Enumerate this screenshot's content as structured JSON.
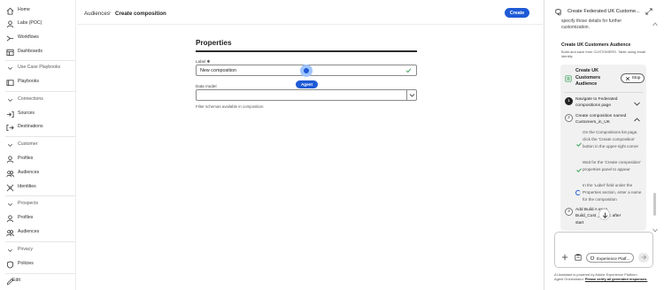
{
  "sidebar": {
    "home": "Home",
    "labs": "Labs (POC)",
    "workflows": "Workflows",
    "dashboards": "Dashboards",
    "use_case_playbooks": "Use Case Playbooks",
    "playbooks": "Playbooks",
    "connections": "Connections",
    "sources": "Sources",
    "destinations": "Destinations",
    "customer": "Customer",
    "customer_profiles": "Profiles",
    "customer_audiences": "Audiences",
    "identities": "Identities",
    "prospects": "Prospects",
    "prospect_profiles": "Profiles",
    "prospect_audiences": "Audiences",
    "privacy": "Privacy",
    "policies": "Policies",
    "edit": "Edit"
  },
  "header": {
    "breadcrumb_parent": "Audiences",
    "breadcrumb_separator": "›",
    "breadcrumb_current": "Create composition",
    "create_button": "Create"
  },
  "form": {
    "section_title": "Properties",
    "label_field_label": "Label ✱",
    "label_field_value": "New composition",
    "agent_badge": "Agent",
    "data_model_label": "Data model",
    "data_model_value": "",
    "data_model_help": "Filter schemas available in composition"
  },
  "assistant": {
    "title": "Create Federated UK Custome...",
    "intro": "specify those details for further customization.",
    "section_title": "Create UK Customers Audience",
    "section_desc": "Build and save from CUSTOMERS. Table using email identity",
    "card_title": "Create UK Customers Audience",
    "stop_button": "Stop",
    "steps": [
      {
        "num": "1",
        "text": "Navigate to Federated compositions page"
      },
      {
        "num": "2",
        "text": "Create composition named Customers_in_UK"
      },
      {
        "num": "3",
        "text": "Add Build A   ence Build_Cust    _in_UK after start"
      }
    ],
    "substeps": [
      "On the Compositions list page, click the 'Create composition' button in the upper-right corner",
      "Wait for the 'Create composition' properties panel to appear",
      "In the 'Label' field under the Properties section, enter a name for the composition"
    ],
    "chip_label": "Experience Platf...",
    "footer_line1": "AI Assistant is powered by Adobe Experience Platform",
    "footer_line2_prefix": "Agent Orchestrator. ",
    "footer_line2_link": "Please verify all generated responses.",
    "accent_color": "#1f5ad6"
  }
}
